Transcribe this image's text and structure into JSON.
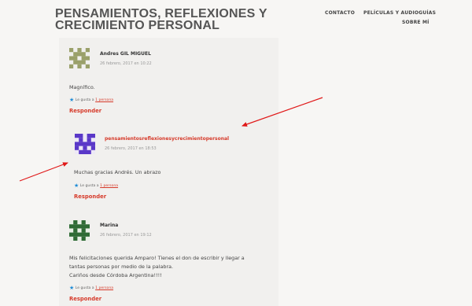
{
  "site": {
    "title": "PENSAMIENTOS, REFLEXIONES Y CRECIMIENTO PERSONAL"
  },
  "nav": {
    "items": [
      "CONTACTO",
      "PELÍCULAS Y AUDIOGUÍAS",
      "SOBRE MÍ"
    ]
  },
  "comments": [
    {
      "author": "Andres GIL MIGUEL",
      "date": "26 febrero, 2017 en 10:22",
      "text": "Magnífico.",
      "like_prefix": "Le gusta a",
      "like_count": "1 persona",
      "reply": "Responder"
    },
    {
      "author": "pensamientosreflexionesycrecimientopersonal",
      "date": "26 febrero, 2017 en 18:53",
      "text": "Muchas gracias Andrés. Un abrazo",
      "like_prefix": "Le gusta a",
      "like_count": "1 persona",
      "reply": "Responder"
    },
    {
      "author": "Marina",
      "date": "26 febrero, 2017 en 19:12",
      "text_lines": [
        "Mis felicitaciones querida Amparo! Tienes el don de escribir y llegar a",
        "tantas personas por medio de la palabra.",
        "Cariños desde Córdoba Argentina!!!!"
      ],
      "like_prefix": "Le gusta a",
      "like_count": "1 persona",
      "reply": "Responder"
    }
  ],
  "colors": {
    "accent": "#d63a2a",
    "star": "#1e8cd6",
    "arrow": "#e01818"
  }
}
